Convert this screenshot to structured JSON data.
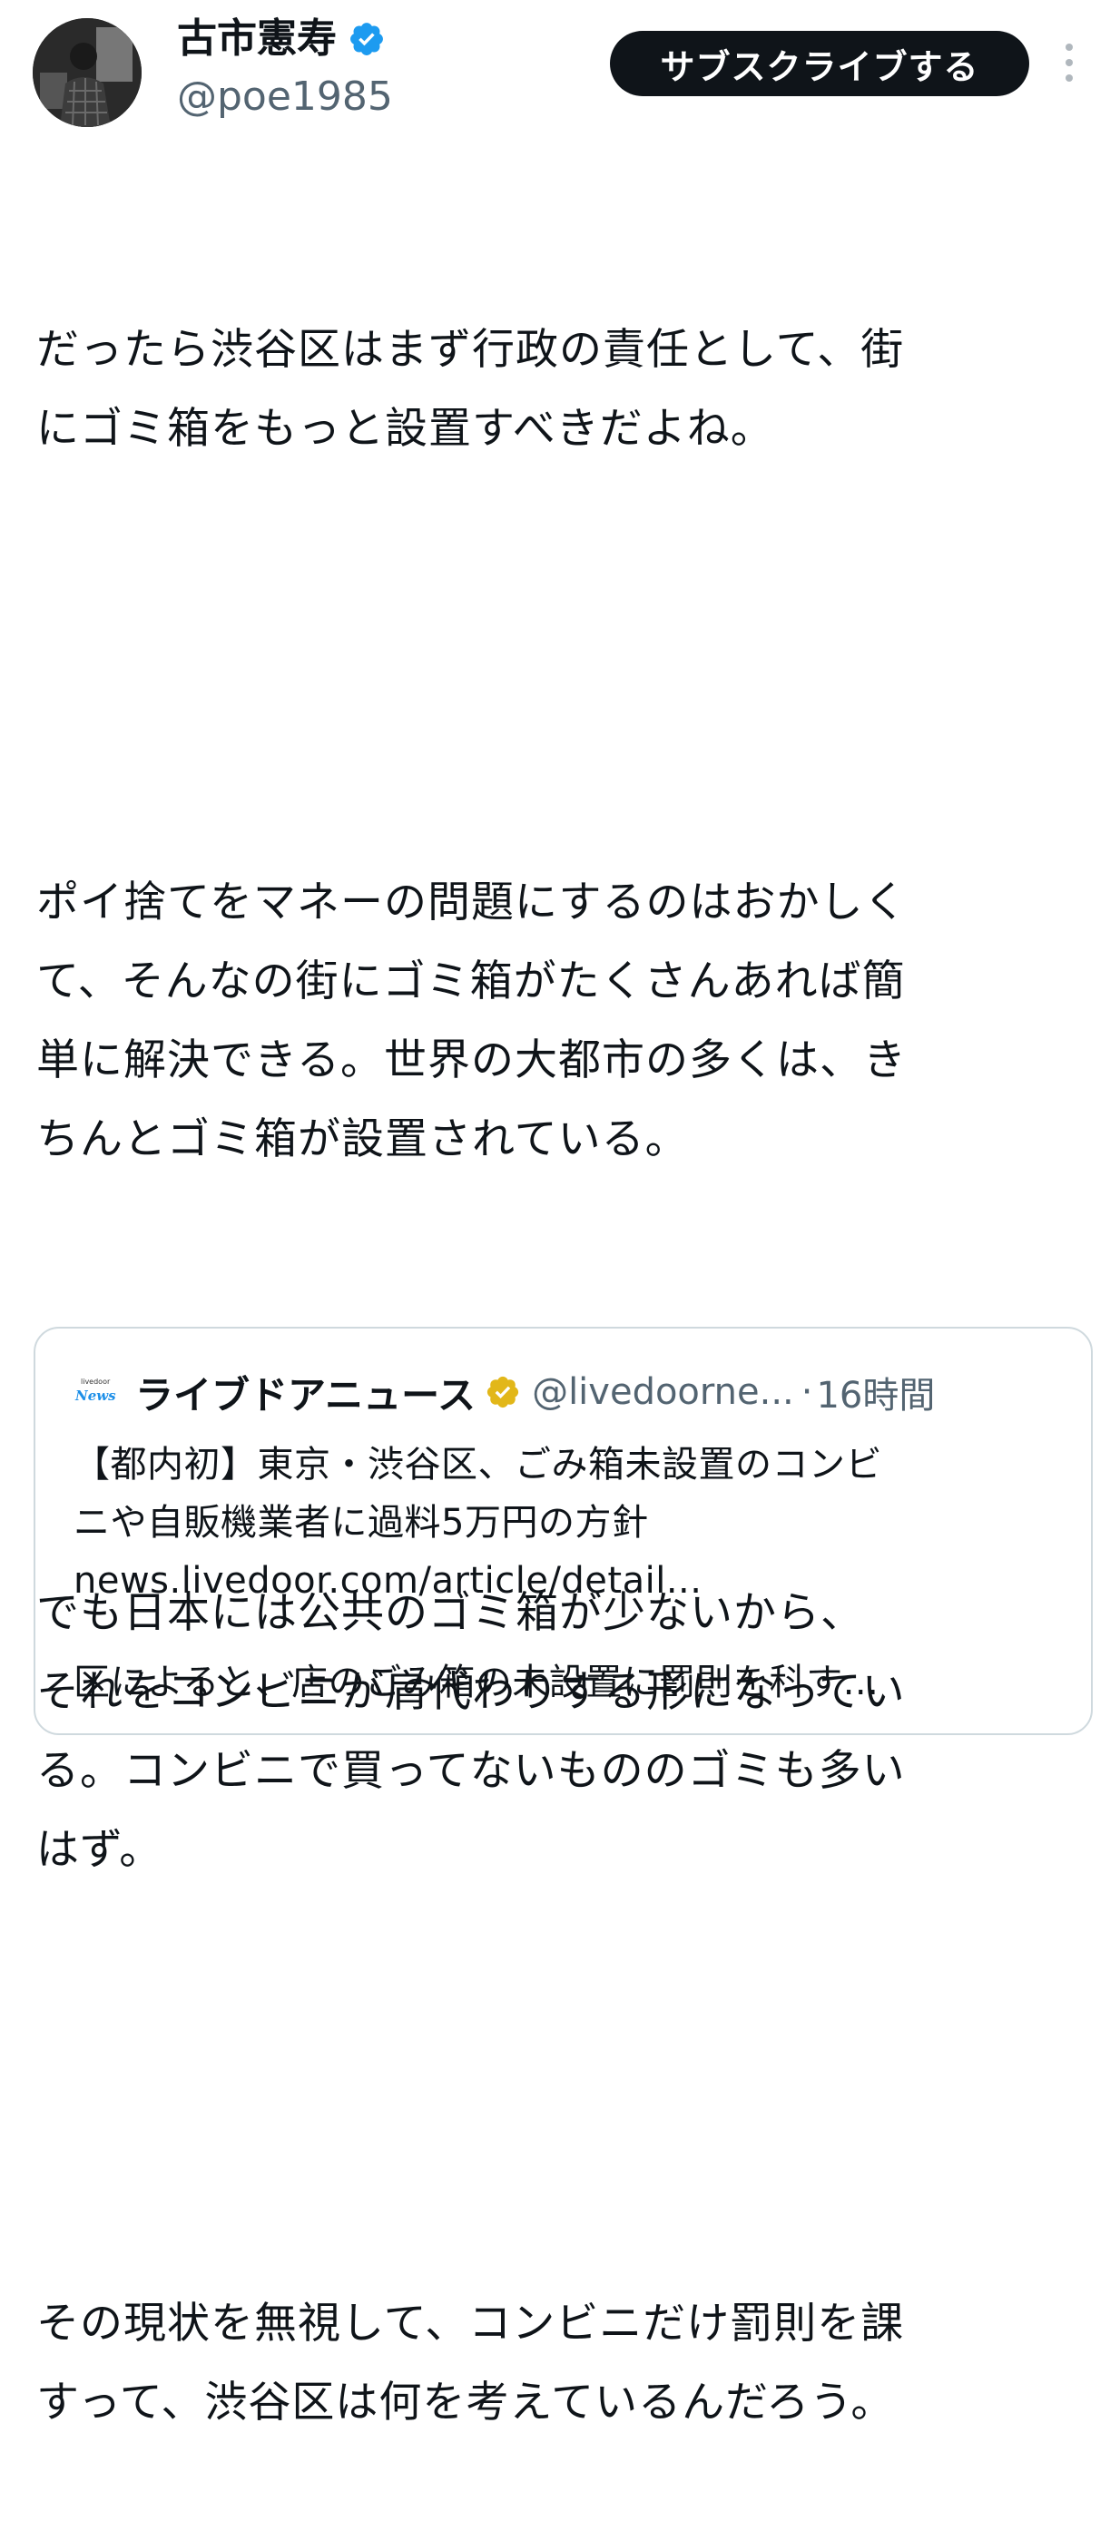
{
  "post": {
    "author": {
      "display_name": "古市憲寿",
      "handle": "@poe1985",
      "verified": true,
      "verified_icon": "blue-checkmark-icon"
    },
    "subscribe_label": "サブスクライブする",
    "more_icon": "vertical-ellipsis-icon",
    "paragraphs": [
      [
        "だったら渋谷区はまず行政の責任として、街",
        "にゴミ箱をもっと設置すべきだよね。"
      ],
      [
        "ポイ捨てをマネーの問題にするのはおかしく",
        "て、そんなの街にゴミ箱がたくさんあれば簡",
        "単に解決できる。世界の大都市の多くは、き",
        "ちんとゴミ箱が設置されている。"
      ],
      [
        "でも日本には公共のゴミ箱が少ないから、",
        "それをコンビニが肩代わりする形になってい",
        "る。コンビニで買ってないもののゴミも多い",
        "はず。"
      ],
      [
        "その現状を無視して、コンビニだけ罰則を課",
        "すって、渋谷区は何を考えているんだろう。"
      ]
    ]
  },
  "quote": {
    "logo_small": "livedoor",
    "logo_word": "News",
    "name": "ライブドアニュース",
    "verified_icon": "gold-checkmark-icon",
    "handle": "@livedoorne...",
    "separator": "·",
    "time": "16時間",
    "headline_lines": [
      "【都内初】東京・渋谷区、ごみ箱未設置のコンビ",
      "ニや自販機業者に過料5万円の方針"
    ],
    "link": "news.livedoor.com/article/detail...",
    "excerpt": "区によると、店のごみ箱の未設置に罰則を科す..."
  },
  "colors": {
    "text": "#0f1419",
    "muted": "#536471",
    "verified_blue": "#1d9bf0",
    "verified_gold": "#e2b719",
    "button_bg": "#0f1419",
    "card_border": "#cfd9de"
  }
}
